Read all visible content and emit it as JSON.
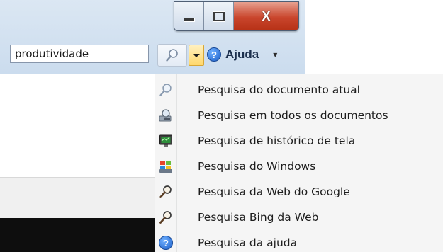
{
  "window": {
    "caption": {
      "minimize_icon": "minimize-icon",
      "maximize_icon": "maximize-icon",
      "close_label": "X"
    }
  },
  "toolbar": {
    "search_value": "produtividade",
    "search_icon": "search-icon",
    "help_label": "Ajuda",
    "help_caret": "▾"
  },
  "search_menu": {
    "items": [
      {
        "label": "Pesquisa do documento atual",
        "icon": "magnifier-icon"
      },
      {
        "label": "Pesquisa em todos os documentos",
        "icon": "documents-search-icon"
      },
      {
        "label": "Pesquisa de histórico de tela",
        "icon": "screen-history-icon"
      },
      {
        "label": "Pesquisa do Windows",
        "icon": "windows-search-icon"
      },
      {
        "label": "Pesquisa da Web do Google",
        "icon": "magnifier-icon"
      },
      {
        "label": "Pesquisa Bing da Web",
        "icon": "magnifier-icon"
      },
      {
        "label": "Pesquisa da ajuda",
        "icon": "help-icon"
      }
    ]
  },
  "colors": {
    "dropdown_accent": "#ffd86c",
    "close_button": "#c9452c"
  }
}
